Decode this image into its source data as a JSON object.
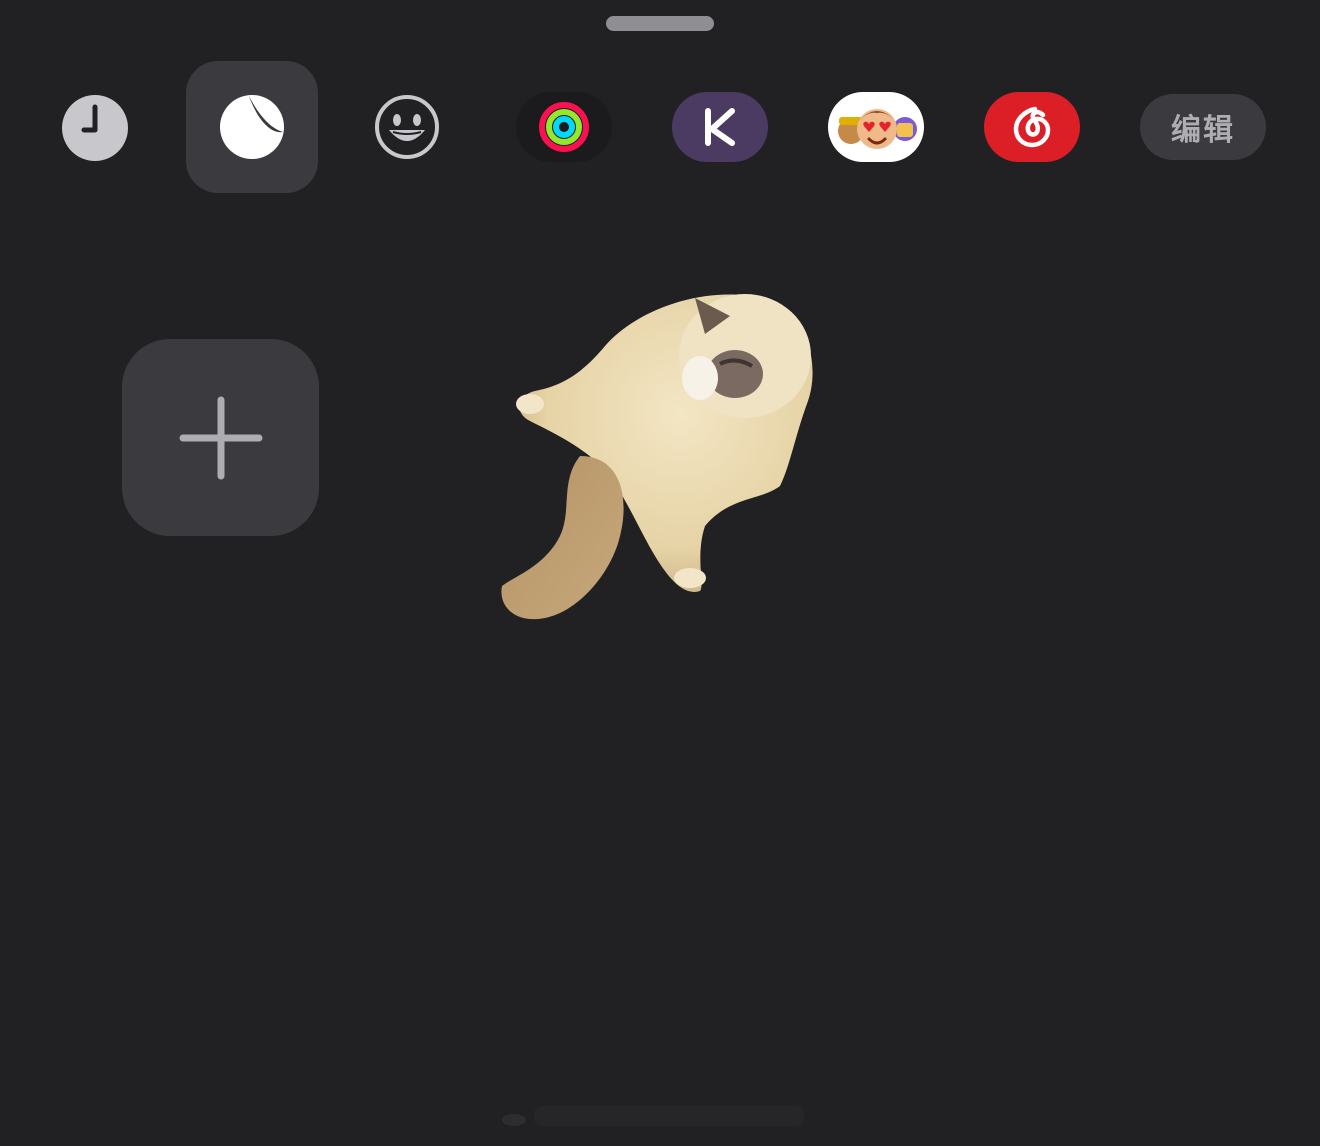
{
  "grabber": {
    "icon": "grabber-handle"
  },
  "toolbar": {
    "items": [
      {
        "name": "clock",
        "icon": "clock-icon",
        "color": "#c7c7cc"
      },
      {
        "name": "sleep",
        "icon": "sleep-moon-icon",
        "selected": true,
        "color": "#ffffff"
      },
      {
        "name": "emoji",
        "icon": "smiley-face-icon",
        "color": "#c7c7cc"
      },
      {
        "name": "activity",
        "icon": "activity-rings-icon",
        "colors": [
          "#fa114f",
          "#92e82a",
          "#00d8ff"
        ]
      },
      {
        "name": "keep",
        "icon": "keep-k-icon",
        "color": "#4b3b63"
      },
      {
        "name": "memoji",
        "icon": "memoji-stickers-icon"
      },
      {
        "name": "netease-music",
        "icon": "netease-cloud-music-icon",
        "color": "#dc1f26"
      }
    ],
    "edit_label": "编辑"
  },
  "widgets": {
    "add_button": {
      "icon": "plus-icon"
    }
  },
  "sticker": {
    "icon": "cat-sticker-image"
  }
}
